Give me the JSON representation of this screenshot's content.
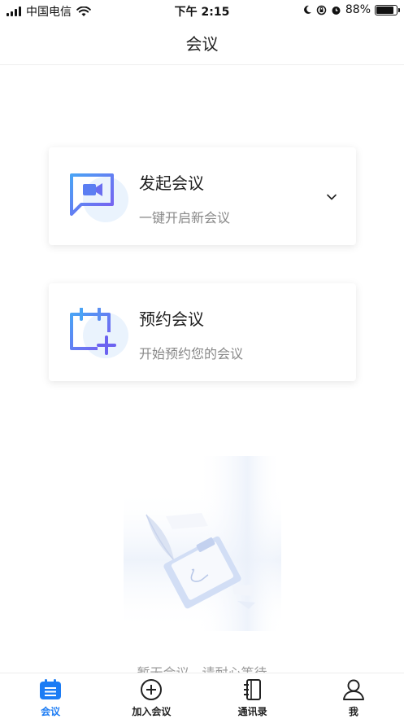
{
  "status_bar": {
    "carrier": "中国电信",
    "time": "下午 2:15",
    "battery_percent": "88%",
    "battery_level": 0.88
  },
  "nav": {
    "title": "会议"
  },
  "cards": [
    {
      "title": "发起会议",
      "subtitle": "一键开启新会议",
      "icon": "video-chat-icon",
      "has_dropdown": true
    },
    {
      "title": "预约会议",
      "subtitle": "开始预约您的会议",
      "icon": "calendar-add-icon",
      "has_dropdown": false
    }
  ],
  "empty_state": {
    "text": "暂无会议，请耐心等待"
  },
  "tabs": [
    {
      "label": "会议",
      "icon": "meeting-list-icon",
      "active": true
    },
    {
      "label": "加入会议",
      "icon": "plus-circle-icon",
      "active": false
    },
    {
      "label": "通讯录",
      "icon": "contacts-book-icon",
      "active": false
    },
    {
      "label": "我",
      "icon": "person-icon",
      "active": false
    }
  ],
  "colors": {
    "accent": "#1c7cf4",
    "icon_gradient_start": "#4aa3f5",
    "icon_gradient_end": "#7b5cf0"
  }
}
